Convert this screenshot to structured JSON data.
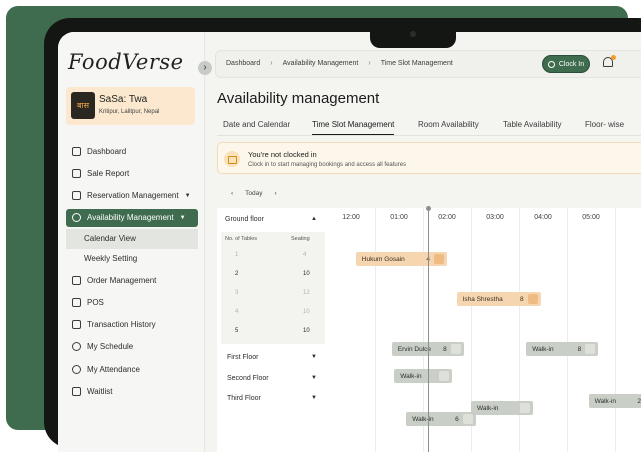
{
  "brand": {
    "logo_text": "FoodVerse"
  },
  "outlet": {
    "logo_text": "बास",
    "name": "SaSa: Twa",
    "location": "Kritipur, Lalitpur, Nepal"
  },
  "sidebar": {
    "items": [
      {
        "label": "Dashboard",
        "icon": "dashboard-icon"
      },
      {
        "label": "Sale Report",
        "icon": "bar-chart-icon"
      },
      {
        "label": "Reservation Management",
        "icon": "calendar-icon",
        "has_caret": true
      },
      {
        "label": "Availability Management",
        "icon": "clock-icon",
        "has_caret": true,
        "active": true
      },
      {
        "label": "Order Management",
        "icon": "order-icon"
      },
      {
        "label": "POS",
        "icon": "pos-icon"
      },
      {
        "label": "Transaction History",
        "icon": "receipt-icon"
      },
      {
        "label": "My Schedule",
        "icon": "watch-icon"
      },
      {
        "label": "My Attendance",
        "icon": "stopwatch-icon"
      },
      {
        "label": "Waitlist",
        "icon": "list-icon"
      }
    ],
    "subitems": [
      {
        "label": "Calendar View",
        "active": true
      },
      {
        "label": "Weekly Setting"
      }
    ]
  },
  "topbar": {
    "crumbs": [
      "Dashboard",
      "Availability Management",
      "Time Slot Management"
    ],
    "clockin_label": "Clock In"
  },
  "page": {
    "title": "Availability management"
  },
  "tabs": [
    {
      "label": "Date and Calendar"
    },
    {
      "label": "Time Slot Management",
      "active": true
    },
    {
      "label": "Room Availability"
    },
    {
      "label": "Table Availability"
    },
    {
      "label": "Floor- wise"
    }
  ],
  "alert": {
    "title": "You're not clocked in",
    "message": "Clock in to start managing bookings and access all features"
  },
  "daynav": {
    "prev": "‹",
    "label": "Today",
    "next": "›"
  },
  "timeline": {
    "hours": [
      "12:00",
      "01:00",
      "02:00",
      "03:00",
      "04:00",
      "05:00"
    ],
    "ground_floor": {
      "label": "Ground floor",
      "col_tables": "No. of Tables",
      "col_seating": "Seating",
      "rows": [
        {
          "table": "1",
          "seating": "4",
          "dim": true
        },
        {
          "table": "2",
          "seating": "10",
          "dim": false
        },
        {
          "table": "3",
          "seating": "12",
          "dim": true
        },
        {
          "table": "4",
          "seating": "10",
          "dim": true
        },
        {
          "table": "5",
          "seating": "10",
          "dim": false
        }
      ]
    },
    "floors": [
      "First Floor",
      "Second Floor",
      "Third Floor"
    ],
    "bookings": [
      {
        "name": "Hukum Gosain",
        "count": "4",
        "color": "orange",
        "start_hour": 0.1,
        "end_hour": 2.0,
        "row": 0
      },
      {
        "name": "Isha Shrestha",
        "count": "8",
        "color": "orange",
        "start_hour": 2.2,
        "end_hour": 3.95,
        "row": 1
      },
      {
        "name": "Ervin Dulce",
        "count": "8",
        "color": "grey",
        "start_hour": 0.85,
        "end_hour": 2.35,
        "row": 2
      },
      {
        "name": "Walk-in",
        "count": "8",
        "color": "grey",
        "start_hour": 3.65,
        "end_hour": 5.15,
        "row": 2
      },
      {
        "name": "Walk-in",
        "count": "",
        "color": "grey",
        "start_hour": 0.9,
        "end_hour": 2.1,
        "row": 3
      },
      {
        "name": "Walk-in",
        "count": "2",
        "color": "grey",
        "start_hour": 4.95,
        "end_hour": 6.6,
        "row": 4
      },
      {
        "name": "Walk-in",
        "count": "",
        "color": "grey",
        "start_hour": 2.5,
        "end_hour": 3.8,
        "row": 5
      },
      {
        "name": "Walk-in",
        "count": "6",
        "color": "grey",
        "start_hour": 1.15,
        "end_hour": 2.6,
        "row": 6
      }
    ],
    "now_hour": 1.6
  }
}
